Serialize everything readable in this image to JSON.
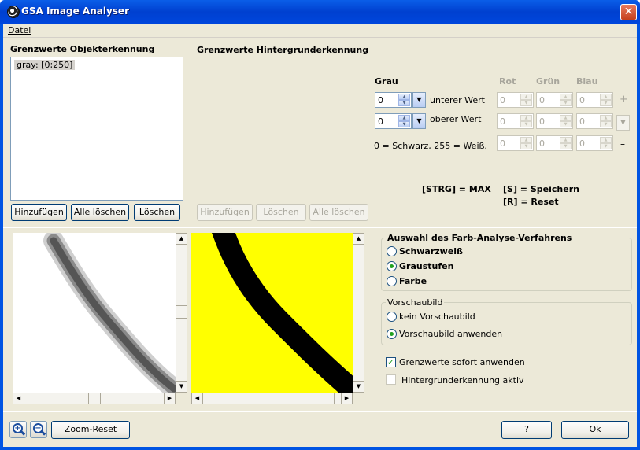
{
  "window": {
    "title": "GSA Image Analyser",
    "close_glyph": "✕"
  },
  "menu": {
    "file": "Datei"
  },
  "object_section": {
    "title": "Grenzwerte Objekterkennung",
    "list_items": [
      "gray:  [0;250]"
    ],
    "add_button": "Hinzufügen",
    "clear_all_button": "Alle löschen",
    "delete_button": "Löschen"
  },
  "background_section": {
    "title": "Grenzwerte Hintergrunderkennung",
    "gray_label": "Grau",
    "red_label": "Rot",
    "green_label": "Grün",
    "blue_label": "Blau",
    "lower_label": "unterer Wert",
    "upper_label": "oberer Wert",
    "hint": "0 = Schwarz, 255 = Weiß.",
    "gray_lower": "0",
    "gray_upper": "0",
    "rgb_row1": [
      "0",
      "0",
      "0"
    ],
    "rgb_row2": [
      "0",
      "0",
      "0"
    ],
    "rgb_row3": [
      "0",
      "0",
      "0"
    ],
    "plus": "+",
    "minus": "–",
    "add_button": "Hinzufügen",
    "delete_button": "Löschen",
    "clear_all_button": "Alle löschen"
  },
  "shortcuts": {
    "strg_max": "[STRG] = MAX",
    "save": "[S] = Speichern",
    "reset": "[R] = Reset"
  },
  "analysis_group": {
    "title": "Auswahl des Farb-Analyse-Verfahrens",
    "options": [
      "Schwarzweiß",
      "Graustufen",
      "Farbe"
    ],
    "selected": "Graustufen"
  },
  "preview_group": {
    "title": "Vorschaubild",
    "options": [
      "kein Vorschaubild",
      "Vorschaubild anwenden"
    ],
    "selected": "Vorschaubild anwenden"
  },
  "checkboxes": {
    "apply_immediately": "Grenzwerte sofort anwenden",
    "apply_immediately_checked": true,
    "background_active": "Hintergrunderkennung aktiv",
    "background_active_checked": false
  },
  "footer": {
    "zoom_reset": "Zoom-Reset",
    "help": "?",
    "ok": "Ok"
  },
  "colors": {
    "highlight_yellow": "#ffff00",
    "selection_green": "#21a121",
    "xp_blue": "#0054e3"
  }
}
